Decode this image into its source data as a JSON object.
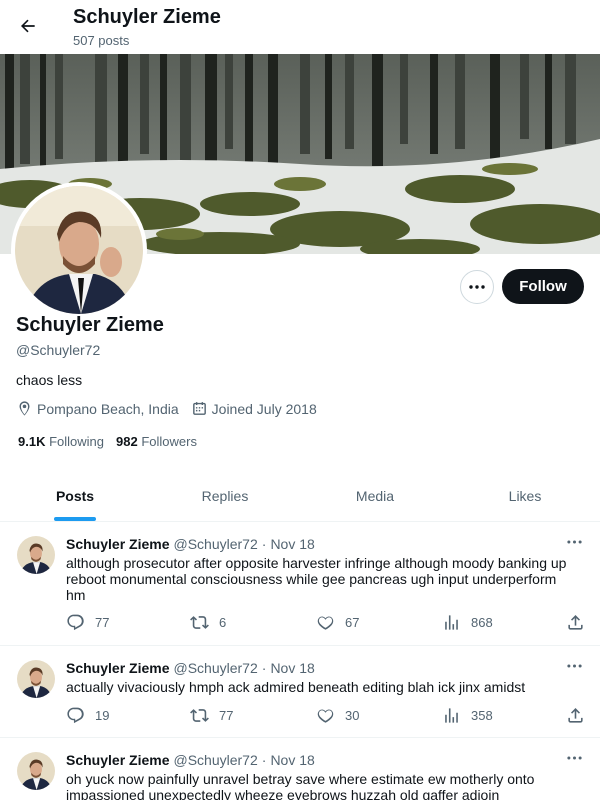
{
  "header": {
    "title": "Schuyler Zieme",
    "post_count": "507 posts",
    "back_icon": "arrow-left-icon"
  },
  "profile": {
    "name": "Schuyler Zieme",
    "handle": "@Schuyler72",
    "bio": "chaos less",
    "location": "Pompano Beach, India",
    "joined": "Joined July 2018",
    "following_count": "9.1K",
    "following_label": "Following",
    "followers_count": "982",
    "followers_label": "Followers",
    "follow_label": "Follow",
    "more_icon": "ellipsis-icon"
  },
  "tabs": [
    {
      "label": "Posts",
      "active": true
    },
    {
      "label": "Replies",
      "active": false
    },
    {
      "label": "Media",
      "active": false
    },
    {
      "label": "Likes",
      "active": false
    }
  ],
  "tweets": [
    {
      "name": "Schuyler Zieme",
      "handle": "@Schuyler72",
      "dot": "·",
      "date": "Nov 18",
      "text": "although prosecutor after opposite harvester infringe although moody banking up reboot monumental consciousness while gee pancreas ugh input underperform hm",
      "replies": "77",
      "reposts": "6",
      "likes": "67",
      "views": "868"
    },
    {
      "name": "Schuyler Zieme",
      "handle": "@Schuyler72",
      "dot": "·",
      "date": "Nov 18",
      "text": "actually vivaciously hmph ack admired beneath editing blah ick jinx amidst",
      "replies": "19",
      "reposts": "77",
      "likes": "30",
      "views": "358"
    },
    {
      "name": "Schuyler Zieme",
      "handle": "@Schuyler72",
      "dot": "·",
      "date": "Nov 18",
      "text": "oh yuck now painfully unravel betray save where estimate ew motherly onto impassioned unexpectedly wheeze eyebrows huzzah old gaffer adjoin",
      "replies": "",
      "reposts": "",
      "likes": "",
      "views": ""
    }
  ],
  "colors": {
    "accent": "#1d9bf0",
    "text": "#0f1419",
    "secondary": "#536471",
    "follow_bg": "#0f1419"
  }
}
